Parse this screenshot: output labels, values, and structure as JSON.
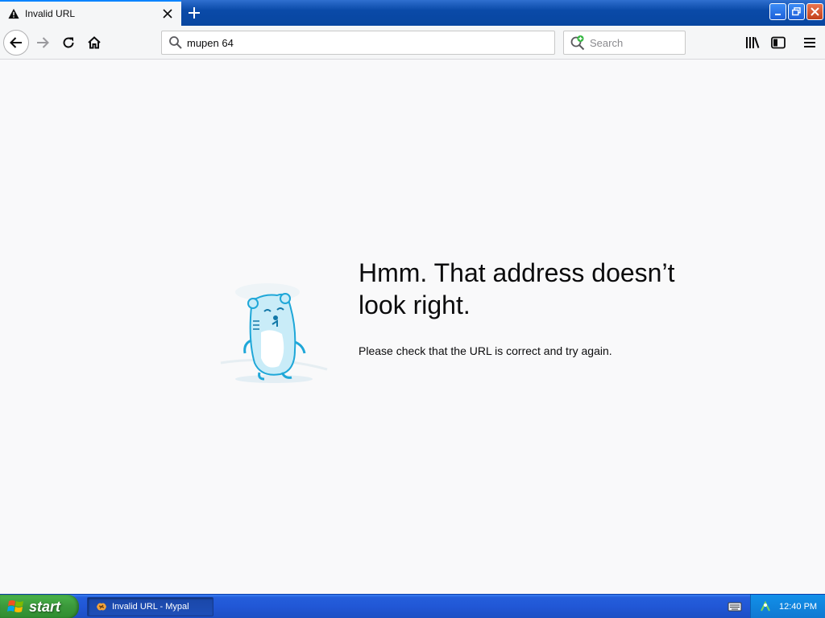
{
  "tab": {
    "title": "Invalid URL"
  },
  "navbar": {
    "url_value": "mupen 64",
    "search_placeholder": "Search"
  },
  "error": {
    "title": "Hmm. That address doesn’t look right.",
    "description": "Please check that the URL is correct and try again."
  },
  "taskbar": {
    "start_label": "start",
    "window_item": "Invalid URL - Mypal",
    "clock": "12:40 PM"
  },
  "colors": {
    "titlebar": "#0a4aa8",
    "tab_bg": "#f5f6f7",
    "page_bg": "#f9f9fa",
    "start_green": "#3c9a3c",
    "taskbar_blue": "#2157d6",
    "close_red": "#c2411b"
  },
  "icons": {
    "tab": [
      "warning-icon",
      "close-icon",
      "plus-icon"
    ],
    "window": [
      "minimize-icon",
      "restore-icon",
      "close-icon"
    ],
    "nav": [
      "arrow-left-icon",
      "arrow-right-icon",
      "reload-icon",
      "home-icon",
      "search-icon",
      "library-icon",
      "sidebar-icon",
      "hamburger-menu-icon"
    ]
  }
}
